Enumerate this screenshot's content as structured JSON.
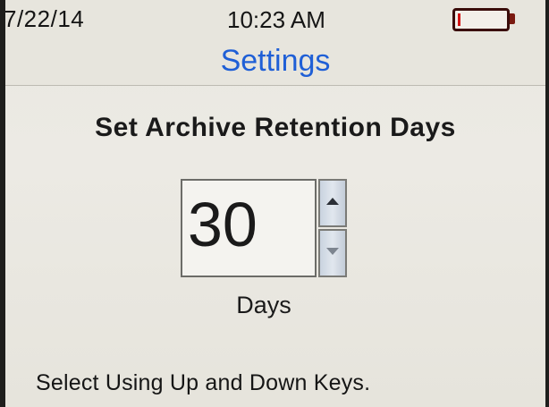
{
  "status_bar": {
    "date": "7/22/14",
    "time": "10:23 AM",
    "battery_icon": "battery-low-icon",
    "battery_level_percent": 5,
    "battery_color": "#d41414"
  },
  "page": {
    "title": "Settings",
    "title_color": "#1f5fd6"
  },
  "setting": {
    "heading": "Set Archive Retention Days",
    "value": "30",
    "unit": "Days",
    "up_icon": "arrow-up-icon",
    "down_icon": "arrow-down-icon"
  },
  "footer": {
    "hint": "Select Using Up and Down Keys."
  }
}
